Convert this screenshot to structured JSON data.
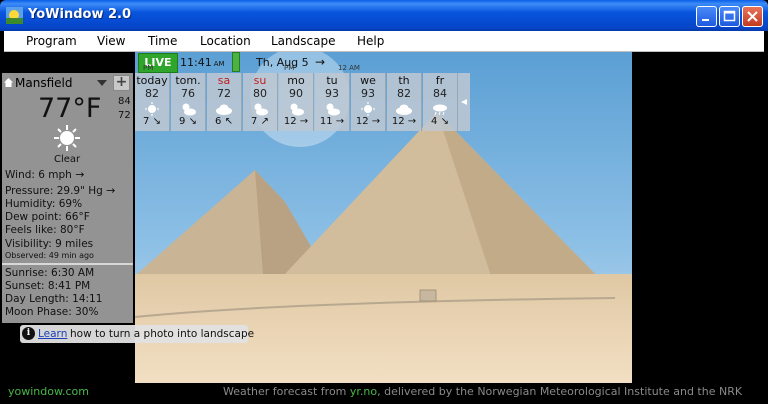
{
  "window": {
    "title": "YoWindow 2.0"
  },
  "menu": [
    "Program",
    "View",
    "Time",
    "Location",
    "Landscape",
    "Help"
  ],
  "timebar": {
    "live_label": "LIVE",
    "time": "11:41",
    "time_suffix": "AM",
    "pm_label": "PM",
    "pm_label2": "PM",
    "date": "Th, Aug 5",
    "next_tick": "12 AM"
  },
  "location": {
    "name": "Mansfield",
    "temperature": "77°F",
    "high": "84",
    "low": "72",
    "condition": "Clear",
    "wind": "Wind:  6 mph",
    "pressure": "Pressure:  29.9\" Hg",
    "humidity": "Humidity:  69%",
    "dew_point": "Dew point:  66°F",
    "feels_like": "Feels like:  80°F",
    "visibility": "Visibility:  9 miles",
    "observed": "Observed:  49 min ago",
    "sunrise": "Sunrise:  6:30 AM",
    "sunset": "Sunset:  8:41 PM",
    "day_length": "Day Length:  14:11",
    "moon_phase": "Moon Phase:  30%"
  },
  "forecast": [
    {
      "name": "today",
      "temp": "82",
      "wind": "7",
      "icon": "sun-icon",
      "weekend": false
    },
    {
      "name": "tom.",
      "temp": "76",
      "wind": "9",
      "icon": "partly-cloudy-icon",
      "weekend": false
    },
    {
      "name": "sa",
      "temp": "72",
      "wind": "6",
      "icon": "cloud-icon",
      "weekend": true
    },
    {
      "name": "su",
      "temp": "80",
      "wind": "7",
      "icon": "partly-cloudy-icon",
      "weekend": true
    },
    {
      "name": "mo",
      "temp": "90",
      "wind": "12",
      "icon": "partly-cloudy-icon",
      "weekend": false
    },
    {
      "name": "tu",
      "temp": "93",
      "wind": "11",
      "icon": "partly-cloudy-icon",
      "weekend": false
    },
    {
      "name": "we",
      "temp": "93",
      "wind": "12",
      "icon": "sun-icon",
      "weekend": false
    },
    {
      "name": "th",
      "temp": "82",
      "wind": "12",
      "icon": "cloud-icon",
      "weekend": false
    },
    {
      "name": "fr",
      "temp": "84",
      "wind": "4",
      "icon": "rain-icon",
      "weekend": false
    }
  ],
  "tip": {
    "link": "Learn",
    "text": "how to turn a photo into landscape"
  },
  "footer": {
    "site": "yowindow.com",
    "credit_prefix": "Weather forecast from",
    "credit_link": "yr.no",
    "credit_suffix": ", delivered by the Norwegian Meteorological Institute and the NRK"
  },
  "colors": {
    "live": "#2fa52b",
    "weekend": "#c02020",
    "footer_green": "#49b849",
    "titlebar": "#0855dd"
  }
}
